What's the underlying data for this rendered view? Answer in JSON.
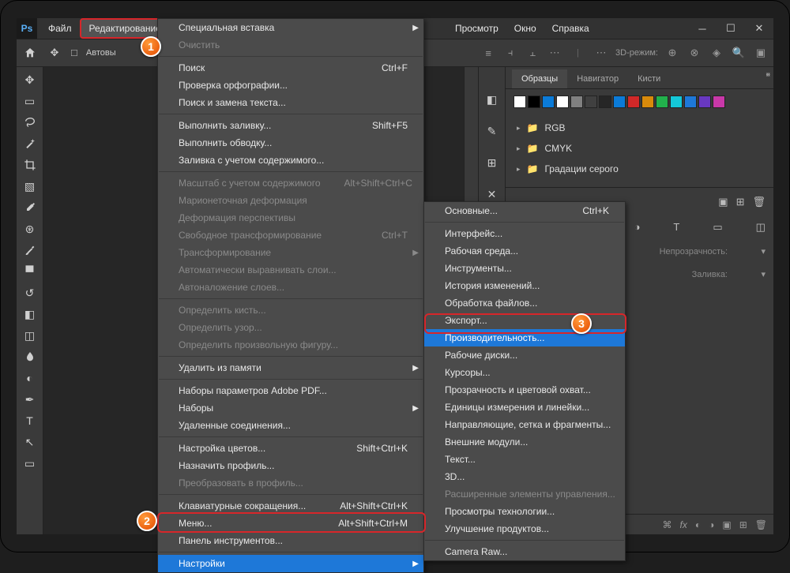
{
  "menubar": {
    "items": [
      "Файл",
      "Редактирование",
      "Просмотр",
      "Окно",
      "Справка"
    ],
    "active_index": 1
  },
  "optbar": {
    "auto_select": "Автовы",
    "mode3d": "3D-режим:"
  },
  "edit_menu": [
    {
      "label": "Специальная вставка",
      "arrow": true
    },
    {
      "label": "Очистить",
      "disabled": true
    },
    {
      "sep": true
    },
    {
      "label": "Поиск",
      "shortcut": "Ctrl+F"
    },
    {
      "label": "Проверка орфографии..."
    },
    {
      "label": "Поиск и замена текста..."
    },
    {
      "sep": true
    },
    {
      "label": "Выполнить заливку...",
      "shortcut": "Shift+F5"
    },
    {
      "label": "Выполнить обводку..."
    },
    {
      "label": "Заливка с учетом содержимого..."
    },
    {
      "sep": true
    },
    {
      "label": "Масштаб с учетом содержимого",
      "shortcut": "Alt+Shift+Ctrl+C",
      "disabled": true
    },
    {
      "label": "Марионеточная деформация",
      "disabled": true
    },
    {
      "label": "Деформация перспективы",
      "disabled": true
    },
    {
      "label": "Свободное трансформирование",
      "shortcut": "Ctrl+T",
      "disabled": true
    },
    {
      "label": "Трансформирование",
      "disabled": true,
      "arrow": true
    },
    {
      "label": "Автоматически выравнивать слои...",
      "disabled": true
    },
    {
      "label": "Автоналожение слоев...",
      "disabled": true
    },
    {
      "sep": true
    },
    {
      "label": "Определить кисть...",
      "disabled": true
    },
    {
      "label": "Определить узор...",
      "disabled": true
    },
    {
      "label": "Определить произвольную фигуру...",
      "disabled": true
    },
    {
      "sep": true
    },
    {
      "label": "Удалить из памяти",
      "arrow": true
    },
    {
      "sep": true
    },
    {
      "label": "Наборы параметров Adobe PDF..."
    },
    {
      "label": "Наборы",
      "arrow": true
    },
    {
      "label": "Удаленные соединения..."
    },
    {
      "sep": true
    },
    {
      "label": "Настройка цветов...",
      "shortcut": "Shift+Ctrl+K"
    },
    {
      "label": "Назначить профиль..."
    },
    {
      "label": "Преобразовать в профиль...",
      "disabled": true
    },
    {
      "sep": true
    },
    {
      "label": "Клавиатурные сокращения...",
      "shortcut": "Alt+Shift+Ctrl+K"
    },
    {
      "label": "Меню...",
      "shortcut": "Alt+Shift+Ctrl+M"
    },
    {
      "label": "Панель инструментов..."
    },
    {
      "sep": true
    },
    {
      "label": "Настройки",
      "arrow": true,
      "highlight": true
    }
  ],
  "prefs_menu": [
    {
      "label": "Основные...",
      "shortcut": "Ctrl+K"
    },
    {
      "sep": true
    },
    {
      "label": "Интерфейс..."
    },
    {
      "label": "Рабочая среда..."
    },
    {
      "label": "Инструменты..."
    },
    {
      "label": "История изменений..."
    },
    {
      "label": "Обработка файлов..."
    },
    {
      "label": "Экспорт..."
    },
    {
      "label": "Производительность...",
      "highlight": true
    },
    {
      "label": "Рабочие диски..."
    },
    {
      "label": "Курсоры..."
    },
    {
      "label": "Прозрачность и цветовой охват..."
    },
    {
      "label": "Единицы измерения и линейки..."
    },
    {
      "label": "Направляющие, сетка и фрагменты..."
    },
    {
      "label": "Внешние модули..."
    },
    {
      "label": "Текст..."
    },
    {
      "label": "3D..."
    },
    {
      "label": "Расширенные элементы управления...",
      "disabled": true
    },
    {
      "label": "Просмотры технологии..."
    },
    {
      "label": "Улучшение продуктов..."
    },
    {
      "sep": true
    },
    {
      "label": "Camera Raw..."
    }
  ],
  "panels": {
    "tabs": [
      "Образцы",
      "Навигатор",
      "Кисти"
    ],
    "swatch_colors": [
      "#ffffff",
      "#000000",
      "#0b7bd8",
      "#ffffff",
      "#808080",
      "#404040",
      "#262626",
      "#0b7bd8",
      "#d02828",
      "#d88a0b",
      "#22b14c",
      "#14c8d8",
      "#1e78d8",
      "#6838c0",
      "#c838a8"
    ],
    "folders": [
      "RGB",
      "CMYK",
      "Градации серого"
    ],
    "layers": {
      "opacity": "Непрозрачность:",
      "fill": "Заливка:"
    }
  },
  "badges": {
    "b1": "1",
    "b2": "2",
    "b3": "3"
  }
}
